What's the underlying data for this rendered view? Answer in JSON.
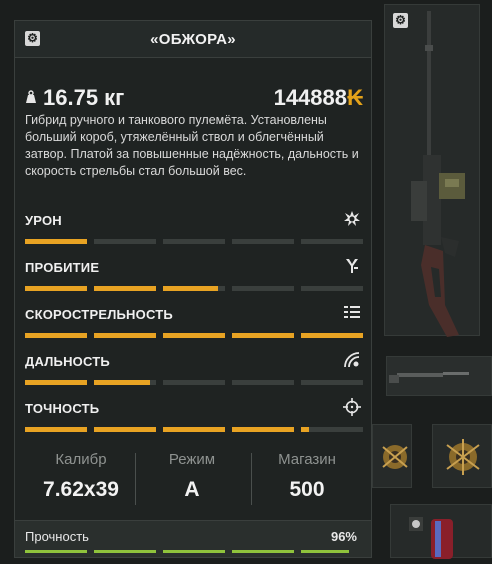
{
  "item": {
    "title": "«ОБЖОРА»",
    "weight": "16.75 кг",
    "price": "144888",
    "currency_symbol": "₭",
    "description": "Гибрид ручного и танкового пулемёта. Установлены больший короб, утяжелённый ствол и облегчённый затвор. Платой за повышенные надёжность, дальность и скорость стрельбы стал большой вес."
  },
  "stats": [
    {
      "label": "УРОН",
      "icon": "impact-icon",
      "level": 0.19
    },
    {
      "label": "ПРОБИТИЕ",
      "icon": "penetration-icon",
      "level": 0.57
    },
    {
      "label": "СКОРОСТРЕЛЬНОСТЬ",
      "icon": "fire-rate-icon",
      "level": 1.0
    },
    {
      "label": "ДАЛЬНОСТЬ",
      "icon": "range-icon",
      "level": 0.37
    },
    {
      "label": "ТОЧНОСТЬ",
      "icon": "crosshair-icon",
      "level": 0.84
    }
  ],
  "specs": {
    "caliber_label": "Калибр",
    "caliber_value": "7.62x39",
    "mode_label": "Режим",
    "mode_value": "А",
    "magazine_label": "Магазин",
    "magazine_value": "500"
  },
  "durability": {
    "label": "Прочность",
    "value": "96%",
    "level": 0.96
  },
  "colors": {
    "accent": "#e8a323",
    "durability": "#8fc33c",
    "currency": "#e3a21a"
  }
}
